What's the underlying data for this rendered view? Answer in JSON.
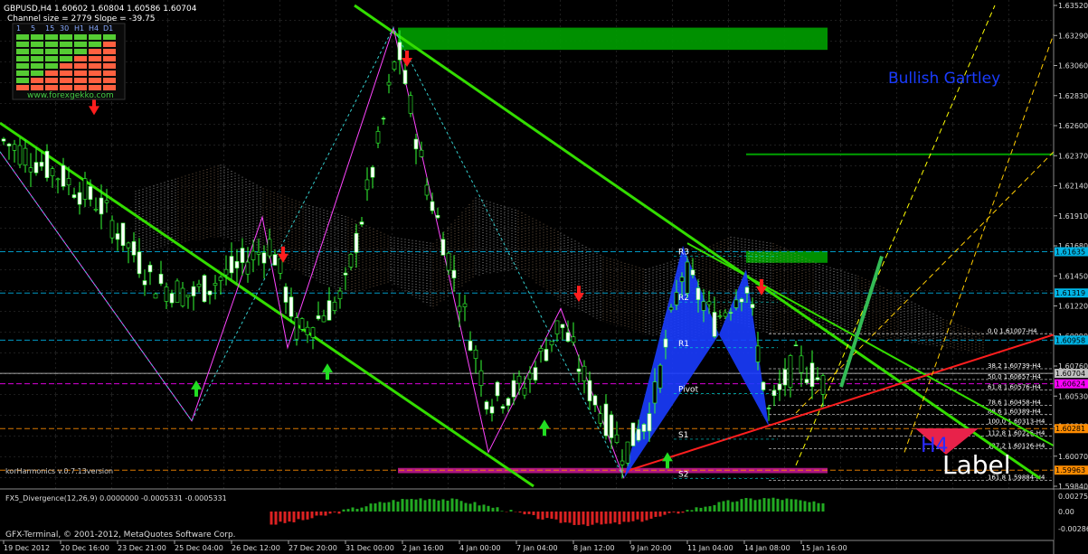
{
  "chart_data": {
    "type": "candlestick",
    "symbol_header": "GBPUSD,H4  1.60602 1.60804 1.60586 1.60704",
    "channel_info": "Channel size = 2779 Slope = -39.75",
    "timeframe_tabs": [
      "1",
      "5",
      "15",
      "30",
      "H1",
      "H4",
      "D1"
    ],
    "watermark_site": "www.forexgekko.com",
    "pattern_title": "Bullish Gartley",
    "indicator_version": "korHarmonics v.0.7.13version",
    "subwindow_header": "FX5_Divergence(12,26,9) 0.0000000 -0.0005331 -0.0005331",
    "copyright": "GFX-Terminal, © 2001-2012, MetaQuotes Software Corp.",
    "big_label_h4": "H4",
    "big_label_text": "Label",
    "price_axis": {
      "min": 1.5984,
      "max": 1.6352,
      "ticks": [
        "1.63520",
        "1.63290",
        "1.63060",
        "1.62830",
        "1.62600",
        "1.62370",
        "1.62140",
        "1.61910",
        "1.61680",
        "1.61450",
        "1.61220",
        "1.60990",
        "1.60760",
        "1.60530",
        "1.60300",
        "1.60070",
        "1.59840"
      ]
    },
    "price_badges": [
      {
        "value": "1.61635",
        "color": "#00b4e6"
      },
      {
        "value": "1.61319",
        "color": "#00b4e6"
      },
      {
        "value": "1.60958",
        "color": "#00b4e6"
      },
      {
        "value": "1.60704",
        "color": "#c0c0c0"
      },
      {
        "value": "1.60624",
        "color": "#ff00ff"
      },
      {
        "value": "1.60281",
        "color": "#ff8c00"
      },
      {
        "value": "1.59963",
        "color": "#ff8c00"
      }
    ],
    "fib_levels": [
      {
        "label": "0.0 1.61007-H4",
        "price": 1.61007
      },
      {
        "label": "38.2 1.60739-H4",
        "price": 1.60739
      },
      {
        "label": "50.0 1.60657-H4",
        "price": 1.60657
      },
      {
        "label": "61.8 1.60576-H4",
        "price": 1.60576
      },
      {
        "label": "78.6 1.60458-H4",
        "price": 1.60458
      },
      {
        "label": "88.6 1.60389-H4",
        "price": 1.60389
      },
      {
        "label": "100.0 1.60313-H4",
        "price": 1.60313
      },
      {
        "label": "112.8 1.60225-H4",
        "price": 1.60225
      },
      {
        "label": "127.2 1.60126-H4",
        "price": 1.60126
      },
      {
        "label": "161.8 1.59884-H4",
        "price": 1.59884
      }
    ],
    "pivot_labels": [
      "R3",
      "R2",
      "R1",
      "Pivot",
      "S1",
      "S2"
    ],
    "time_axis": [
      "19 Dec 2012",
      "20 Dec 16:00",
      "23 Dec 21:00",
      "25 Dec 04:00",
      "26 Dec 12:00",
      "27 Dec 20:00",
      "31 Dec 00:00",
      "2 Jan 16:00",
      "4 Jan 00:00",
      "7 Jan 04:00",
      "8 Jan 12:00",
      "9 Jan 20:00",
      "11 Jan 04:00",
      "14 Jan 08:00",
      "15 Jan 16:00"
    ],
    "osc_axis": {
      "ticks": [
        "0.00275",
        "0.00",
        "-0.00286"
      ]
    },
    "colors": {
      "background": "#000000",
      "grid": "#3a3a3a",
      "channel": "#33dd00",
      "trend": "#ff1e1e",
      "pattern": "#1a3cff",
      "bull_candle": "#ffffff",
      "bear_candle": "#000000"
    }
  }
}
